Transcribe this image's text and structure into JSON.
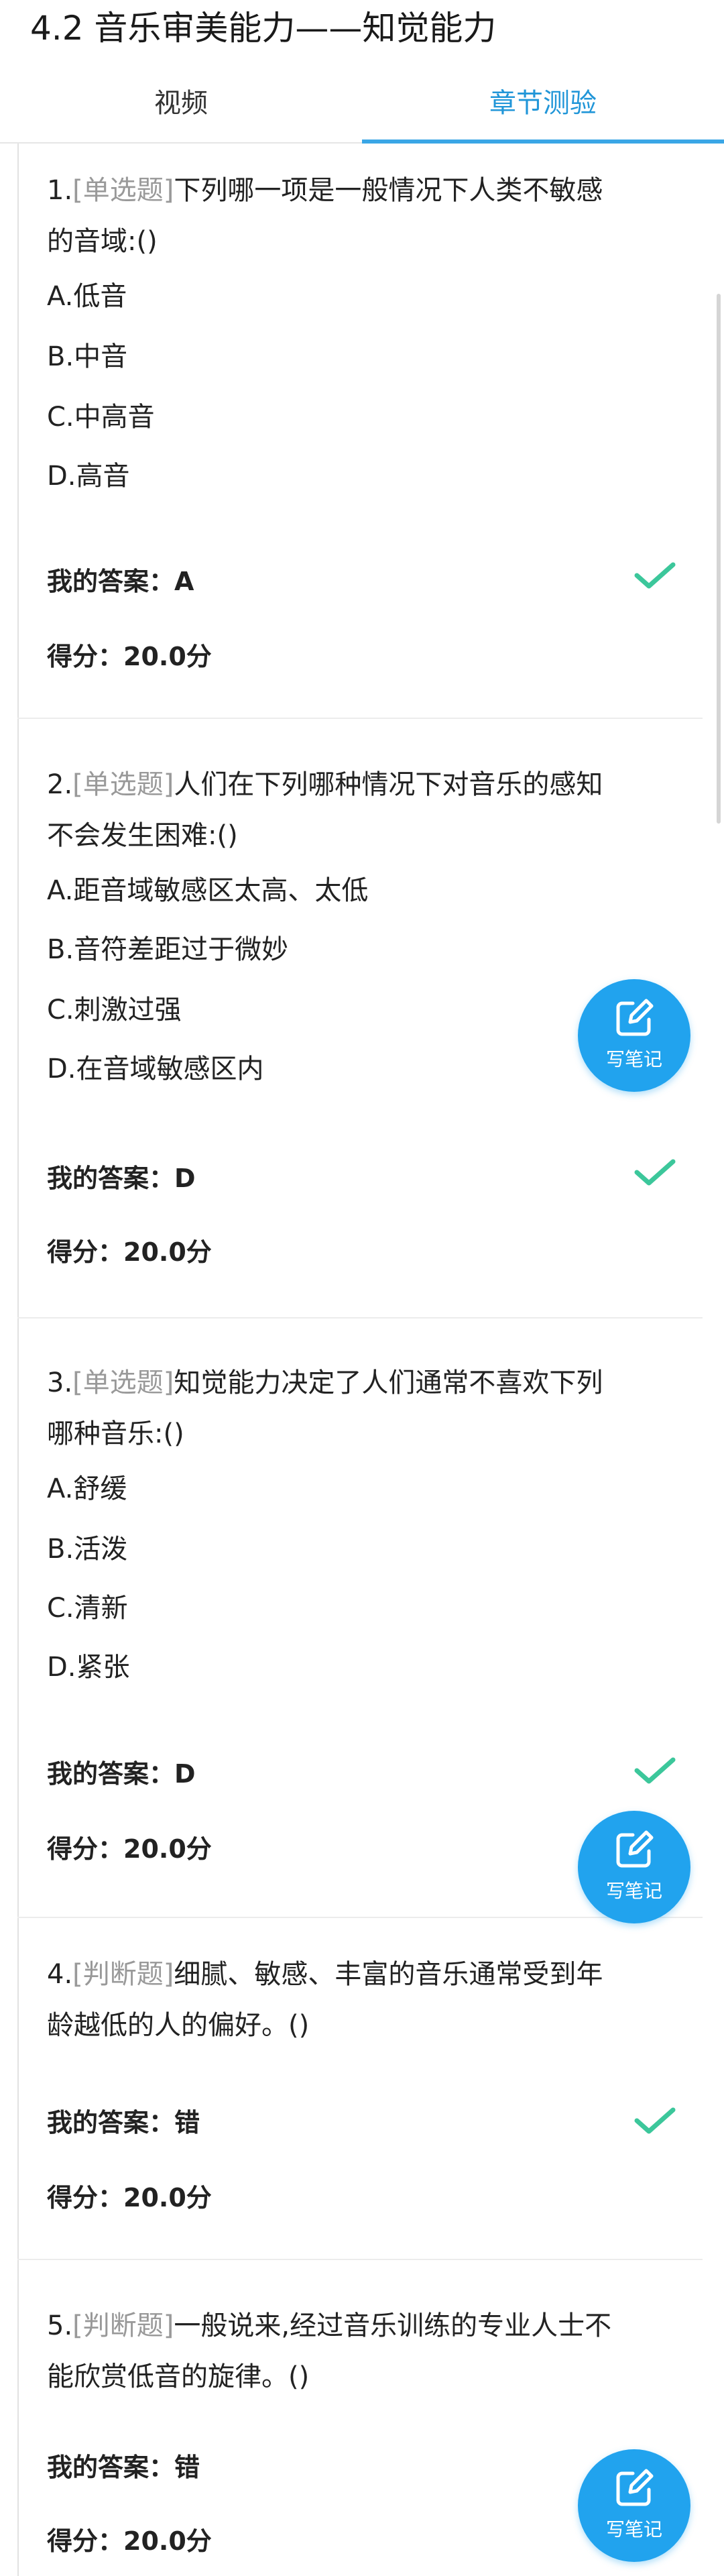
{
  "header": {
    "title": "4.2 音乐审美能力——知觉能力"
  },
  "tabs": [
    {
      "label": "视频",
      "active": false
    },
    {
      "label": "章节测验",
      "active": true
    }
  ],
  "colors": {
    "accent": "#2196d8",
    "check": "#3cc79b",
    "note_button": "#21a3ee",
    "type_tag": "#999999"
  },
  "questions": [
    {
      "number": "1.",
      "type": "[单选题]",
      "line1": "下列哪一项是一般情况下人类不敏感",
      "line2": "的音域:()",
      "options": [
        "A.低音",
        "B.中音",
        "C.中高音",
        "D.高音"
      ],
      "answer": "我的答案：A",
      "score": "得分：20.0分",
      "result_icon": "check-icon"
    },
    {
      "number": "2.",
      "type": "[单选题]",
      "line1": "人们在下列哪种情况下对音乐的感知",
      "line2": "不会发生困难:()",
      "options": [
        "A.距音域敏感区太高、太低",
        "B.音符差距过于微妙",
        "C.刺激过强",
        "D.在音域敏感区内"
      ],
      "answer": "我的答案：D",
      "score": "得分：20.0分",
      "result_icon": "check-icon"
    },
    {
      "number": "3.",
      "type": "[单选题]",
      "line1": "知觉能力决定了人们通常不喜欢下列",
      "line2": "哪种音乐:()",
      "options": [
        "A.舒缓",
        "B.活泼",
        "C.清新",
        "D.紧张"
      ],
      "answer": "我的答案：D",
      "score": "得分：20.0分",
      "result_icon": "check-icon"
    },
    {
      "number": "4.",
      "type": "[判断题]",
      "line1": "细腻、敏感、丰富的音乐通常受到年",
      "line2": "龄越低的人的偏好。()",
      "options": [],
      "answer": "我的答案：错",
      "score": "得分：20.0分",
      "result_icon": "check-icon"
    },
    {
      "number": "5.",
      "type": "[判断题]",
      "line1": "一般说来,经过音乐训练的专业人士不",
      "line2": "能欣赏低音的旋律。()",
      "options": [],
      "answer": "我的答案：错",
      "score": "得分：20.0分"
    }
  ],
  "note_button": {
    "label": "写笔记",
    "icon": "edit-note-icon"
  }
}
